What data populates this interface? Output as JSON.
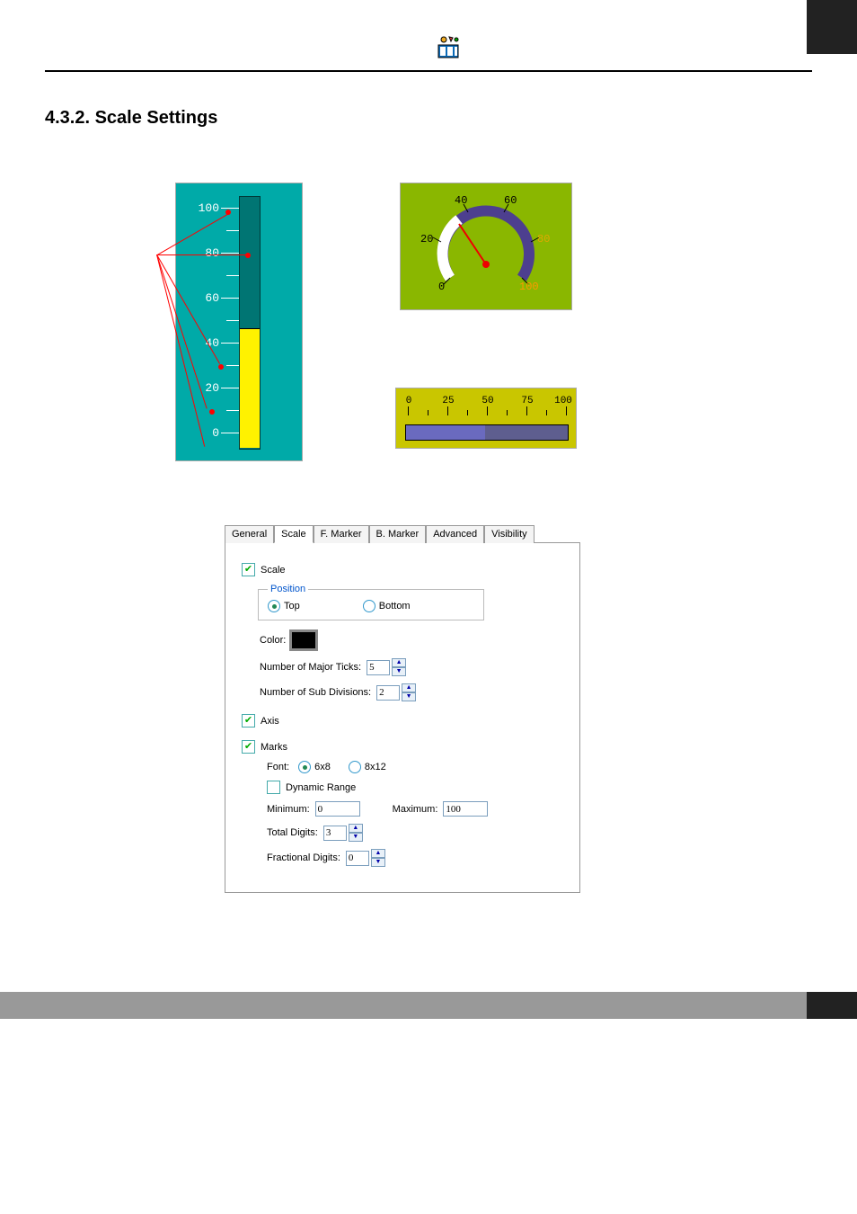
{
  "section_title": "4.3.2. Scale Settings",
  "vbar": {
    "ticks": [
      "100",
      "80",
      "60",
      "40",
      "20",
      "0"
    ]
  },
  "gauge": {
    "ticks": [
      "0",
      "20",
      "40",
      "60",
      "80",
      "100"
    ]
  },
  "hbar": {
    "ticks": [
      "0",
      "25",
      "50",
      "75",
      "100"
    ]
  },
  "dialog": {
    "tabs": {
      "general": "General",
      "scale": "Scale",
      "fmarker": "F. Marker",
      "bmarker": "B. Marker",
      "advanced": "Advanced",
      "visibility": "Visibility"
    },
    "scale_label": "Scale",
    "position_label": "Position",
    "top_label": "Top",
    "bottom_label": "Bottom",
    "color_label": "Color:",
    "major_ticks_label": "Number of Major Ticks:",
    "major_ticks_value": "5",
    "sub_div_label": "Number of Sub Divisions:",
    "sub_div_value": "2",
    "axis_label": "Axis",
    "marks_label": "Marks",
    "font_label": "Font:",
    "font_6x8_label": "6x8",
    "font_8x12_label": "8x12",
    "dynamic_range_label": "Dynamic Range",
    "minimum_label": "Minimum:",
    "minimum_value": "0",
    "maximum_label": "Maximum:",
    "maximum_value": "100",
    "total_digits_label": "Total Digits:",
    "total_digits_value": "3",
    "fractional_digits_label": "Fractional Digits:",
    "fractional_digits_value": "0"
  }
}
